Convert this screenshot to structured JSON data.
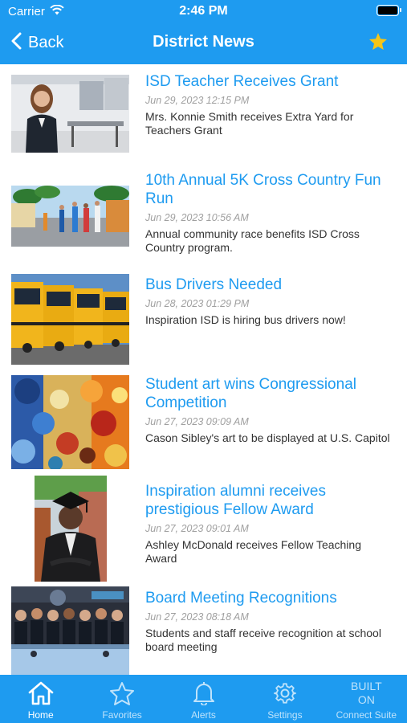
{
  "status_bar": {
    "carrier": "Carrier",
    "time": "2:46 PM"
  },
  "nav": {
    "back_label": "Back",
    "title": "District News"
  },
  "articles": [
    {
      "title": "ISD Teacher Receives Grant",
      "date": "Jun 29, 2023  12:15 PM",
      "summary": "Mrs. Konnie Smith receives Extra Yard for Teachers Grant"
    },
    {
      "title": "10th Annual 5K Cross Country Fun Run",
      "date": "Jun 29, 2023  10:56 AM",
      "summary": "Annual community race benefits ISD Cross Country program."
    },
    {
      "title": "Bus Drivers Needed",
      "date": "Jun 28, 2023  01:29 PM",
      "summary": "Inspiration ISD is hiring bus drivers now!"
    },
    {
      "title": "Student art wins Congressional Competition",
      "date": "Jun 27, 2023  09:09 AM",
      "summary": "Cason Sibley's art to be displayed at U.S. Capitol"
    },
    {
      "title": "Inspiration alumni receives prestigious Fellow Award",
      "date": "Jun 27, 2023  09:01 AM",
      "summary": "Ashley McDonald receives Fellow Teaching Award"
    },
    {
      "title": "Board Meeting Recognitions",
      "date": "Jun 27, 2023  08:18 AM",
      "summary": "Students and staff receive recognition at school board meeting"
    }
  ],
  "tabs": [
    {
      "label": "Home",
      "icon": "home-icon",
      "active": true
    },
    {
      "label": "Favorites",
      "icon": "star-icon"
    },
    {
      "label": "Alerts",
      "icon": "bell-icon"
    },
    {
      "label": "Settings",
      "icon": "gear-icon"
    },
    {
      "label": "Connect Suite",
      "top": "BUILT ON"
    }
  ],
  "colors": {
    "accent": "#1e9bf0",
    "star": "#f5c518"
  }
}
